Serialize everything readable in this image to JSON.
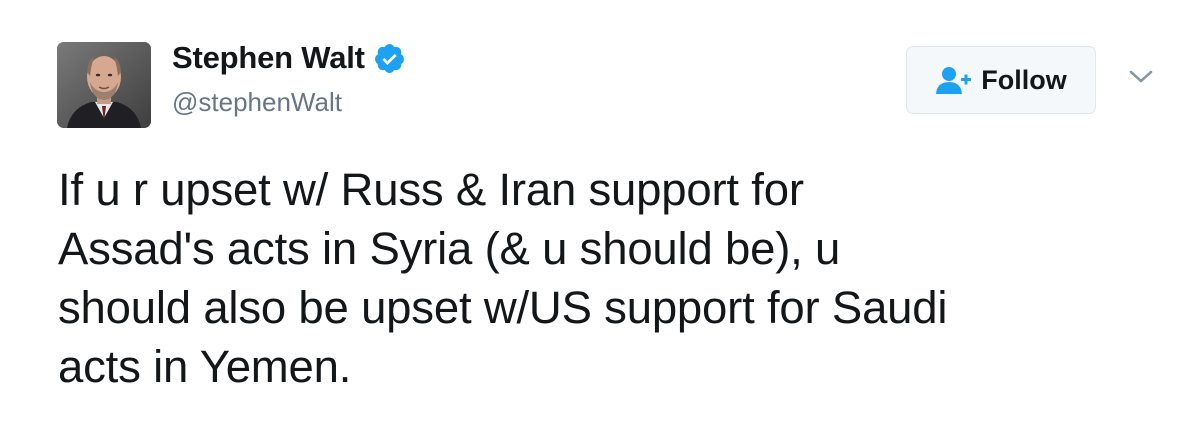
{
  "user": {
    "display_name": "Stephen Walt",
    "screen_name": "@stephenWalt",
    "verified": true,
    "avatar_icon": "profile-photo"
  },
  "actions": {
    "follow_label": "Follow",
    "follow_icon": "add-user-icon",
    "menu_icon": "chevron-down-icon"
  },
  "tweet": {
    "lines": [
      "If u r upset w/ Russ & Iran support for",
      "Assad's acts in Syria (& u should be), u",
      "should also be upset w/US support for Saudi",
      "acts in Yemen."
    ]
  },
  "colors": {
    "text": "#14171a",
    "secondary": "#657786",
    "verified_blue": "#1da1f2",
    "button_bg": "#f5f8fa",
    "button_border": "#e1e8ed"
  }
}
